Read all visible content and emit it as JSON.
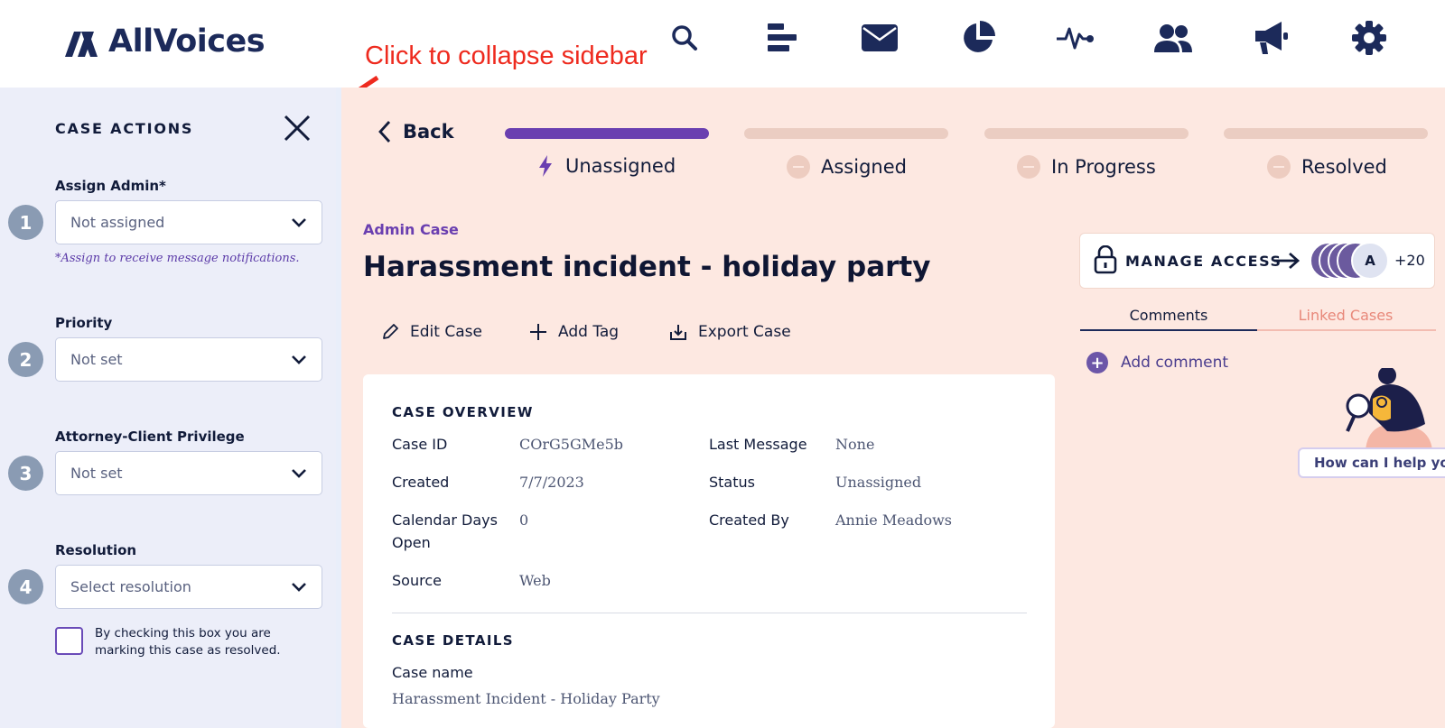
{
  "app": {
    "logo_text": "AllVoices"
  },
  "nav": {
    "icons": [
      "search-icon",
      "bars-icon",
      "mail-icon",
      "pie-chart-icon",
      "activity-icon",
      "users-icon",
      "megaphone-icon",
      "gear-icon"
    ]
  },
  "annotation": {
    "text": "Click to collapse sidebar",
    "color": "#ee2a1e"
  },
  "sidebar": {
    "title": "CASE ACTIONS",
    "fields": [
      {
        "step": "1",
        "label": "Assign Admin*",
        "value": "Not assigned"
      },
      {
        "step": "2",
        "label": "Priority",
        "value": "Not set"
      },
      {
        "step": "3",
        "label": "Attorney-Client Privilege",
        "value": "Not set"
      },
      {
        "step": "4",
        "label": "Resolution",
        "value": "Select resolution"
      }
    ],
    "hint": "*Assign to receive message notifications.",
    "checkbox_text": "By checking this box you are marking this case as resolved.",
    "checkbox_checked": false
  },
  "header": {
    "back_label": "Back",
    "stages": [
      {
        "label": "Unassigned",
        "active": true
      },
      {
        "label": "Assigned",
        "active": false
      },
      {
        "label": "In Progress",
        "active": false
      },
      {
        "label": "Resolved",
        "active": false
      }
    ]
  },
  "case": {
    "type_label": "Admin Case",
    "title": "Harassment incident - holiday party",
    "actions": {
      "edit": "Edit Case",
      "tag": "Add Tag",
      "export": "Export Case"
    },
    "overview": {
      "heading": "CASE OVERVIEW",
      "case_id_label": "Case ID",
      "case_id": "COrG5GMe5b",
      "created_label": "Created",
      "created": "7/7/2023",
      "days_open_label_1": "Calendar Days",
      "days_open_label_2": "Open",
      "days_open": "0",
      "source_label": "Source",
      "source": "Web",
      "last_message_label": "Last Message",
      "last_message": "None",
      "status_label": "Status",
      "status": "Unassigned",
      "created_by_label": "Created By",
      "created_by": "Annie Meadows"
    },
    "details": {
      "heading": "CASE DETAILS",
      "name_label": "Case name",
      "name": "Harassment Incident - Holiday Party"
    }
  },
  "access": {
    "label": "MANAGE ACCESS",
    "avatar_initial": "A",
    "extra_count": "+20"
  },
  "tabs": {
    "comments": "Comments",
    "linked": "Linked Cases",
    "active": "comments"
  },
  "comments": {
    "add_label": "Add comment"
  },
  "helper": {
    "text": "How can I help you"
  },
  "colors": {
    "accent": "#6a3fb0",
    "navy": "#1c2a5a",
    "panel_bg": "#fde8e1",
    "sidebar_bg": "#eceef9",
    "linked_tab": "#e8887a"
  }
}
